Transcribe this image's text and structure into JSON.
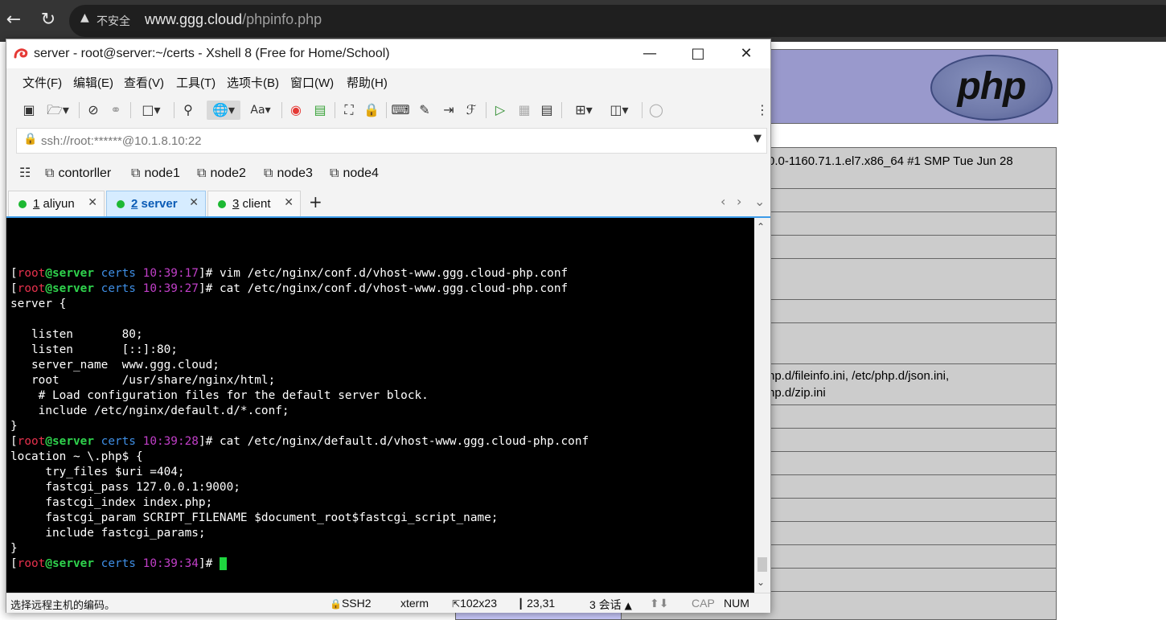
{
  "browser": {
    "back_icon": "arrow-left-icon",
    "reload_icon": "reload-icon",
    "security_warning": "不安全",
    "url_host": "www.ggg.cloud",
    "url_path": "/phpinfo.php"
  },
  "phpinfo": {
    "logo_text": "php",
    "system_value": "0.0-1160.71.1.el7.x86_64 #1 SMP Tue Jun 28",
    "ini_files_line1": "hp.d/fileinfo.ini, /etc/php.d/json.ini,",
    "ini_files_line2": "hp.d/zip.ini"
  },
  "xshell": {
    "title": "server - root@server:~/certs - Xshell 8 (Free for Home/School)",
    "menu": [
      "文件(F)",
      "编辑(E)",
      "查看(V)",
      "工具(T)",
      "选项卡(B)",
      "窗口(W)",
      "帮助(H)"
    ],
    "address": "ssh://root:******@10.1.8.10:22",
    "links": [
      "contorller",
      "node1",
      "node2",
      "node3",
      "node4"
    ],
    "tabs": [
      {
        "num": "1",
        "name": "aliyun"
      },
      {
        "num": "2",
        "name": "server"
      },
      {
        "num": "3",
        "name": "client"
      }
    ],
    "status": {
      "hint": "选择远程主机的编码。",
      "protocol": "SSH2",
      "term": "xterm",
      "size": "102x23",
      "pos": "23,31",
      "sessions": "3 会话",
      "cap": "CAP",
      "num": "NUM"
    }
  },
  "terminal": {
    "prompts": [
      {
        "user": "root",
        "host": "server",
        "dir": "certs",
        "time": "10:39:17",
        "cmd": " vim /etc/nginx/conf.d/vhost-www.ggg.cloud-php.conf"
      },
      {
        "user": "root",
        "host": "server",
        "dir": "certs",
        "time": "10:39:27",
        "cmd": " cat /etc/nginx/conf.d/vhost-www.ggg.cloud-php.conf"
      },
      {
        "user": "root",
        "host": "server",
        "dir": "certs",
        "time": "10:39:28",
        "cmd": " cat /etc/nginx/default.d/vhost-www.ggg.cloud-php.conf"
      },
      {
        "user": "root",
        "host": "server",
        "dir": "certs",
        "time": "10:39:34",
        "cmd": " "
      }
    ],
    "block1": [
      "server {",
      "",
      "   listen       80;",
      "   listen       [::]:80;",
      "   server_name  www.ggg.cloud;",
      "   root         /usr/share/nginx/html;",
      "    # Load configuration files for the default server block.",
      "    include /etc/nginx/default.d/*.conf;",
      "}"
    ],
    "block2": [
      "location ~ \\.php$ {",
      "     try_files $uri =404;",
      "     fastcgi_pass 127.0.0.1:9000;",
      "     fastcgi_index index.php;",
      "     fastcgi_param SCRIPT_FILENAME $document_root$fastcgi_script_name;",
      "     include fastcgi_params;",
      "}"
    ]
  }
}
